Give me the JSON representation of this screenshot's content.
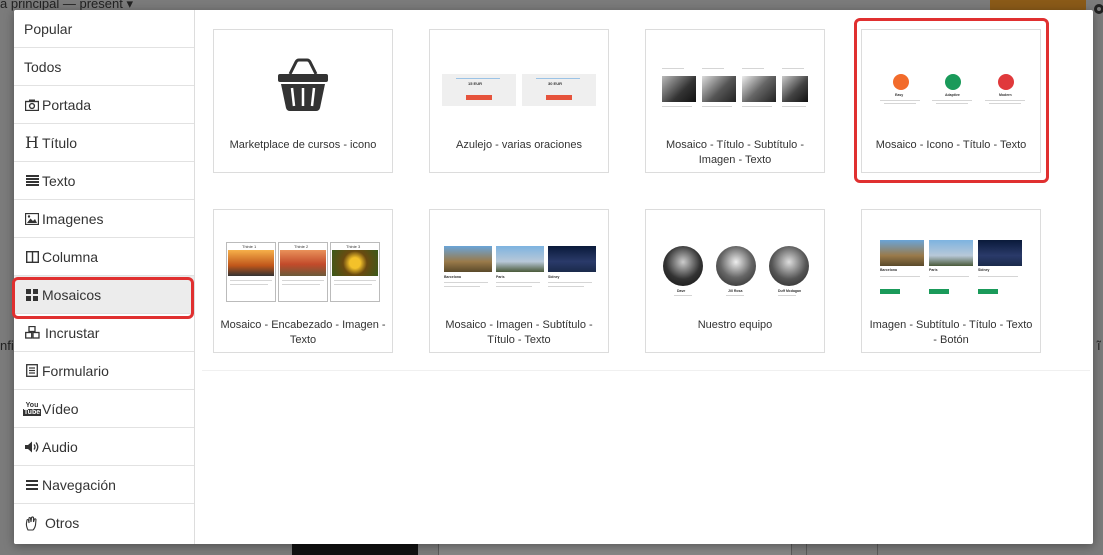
{
  "background": {
    "breadcrumb": "a principal — present ▾",
    "left_fragment": "nfi",
    "right_fragment": "ĩ"
  },
  "sidebar": {
    "items": [
      {
        "label": "Popular",
        "icon": "none"
      },
      {
        "label": "Todos",
        "icon": "none"
      },
      {
        "label": "Portada",
        "icon": "camera-icon"
      },
      {
        "label": "Título",
        "icon": "heading-icon"
      },
      {
        "label": "Texto",
        "icon": "text-lines-icon"
      },
      {
        "label": "Imagenes",
        "icon": "image-icon"
      },
      {
        "label": "Columna",
        "icon": "columns-icon"
      },
      {
        "label": "Mosaicos",
        "icon": "grid-icon"
      },
      {
        "label": "Incrustar",
        "icon": "cubes-icon"
      },
      {
        "label": "Formulario",
        "icon": "form-icon"
      },
      {
        "label": "Vídeo",
        "icon": "youtube-icon"
      },
      {
        "label": "Audio",
        "icon": "speaker-icon"
      },
      {
        "label": "Navegación",
        "icon": "menu-icon"
      },
      {
        "label": "Otros",
        "icon": "hand-icon"
      }
    ],
    "active": "Mosaicos"
  },
  "cards": [
    {
      "label": "Marketplace de cursos - icono"
    },
    {
      "label": "Azulejo - varias oraciones"
    },
    {
      "label": "Mosaico - Título - Subtítulo - Imagen - Texto"
    },
    {
      "label": "Mosaico - Icono - Título - Texto"
    },
    {
      "label": "Mosaico - Encabezado - Imagen - Texto"
    },
    {
      "label": "Mosaico - Imagen - Subtítulo - Título - Texto"
    },
    {
      "label": "Nuestro equipo"
    },
    {
      "label": "Imagen - Subtítulo - Título - Texto - Botón"
    }
  ],
  "thumbs": {
    "azulejo_prices": [
      "15 EUR",
      "30 EUR"
    ],
    "icons_titles": [
      "Easy",
      "Adaptive",
      "Modern"
    ],
    "team_names": [
      "Dave",
      "Jill Rosa",
      "Duff Mcdagan"
    ],
    "cities": [
      "Barcelona",
      "Paris",
      "Sidney"
    ],
    "headers": [
      "Thinie 1",
      "Thinie 2",
      "Thinie 3"
    ]
  },
  "colors": {
    "highlight": "#e03030",
    "orange": "#f26b2b",
    "green": "#1a9a5a",
    "red": "#e0393b"
  }
}
